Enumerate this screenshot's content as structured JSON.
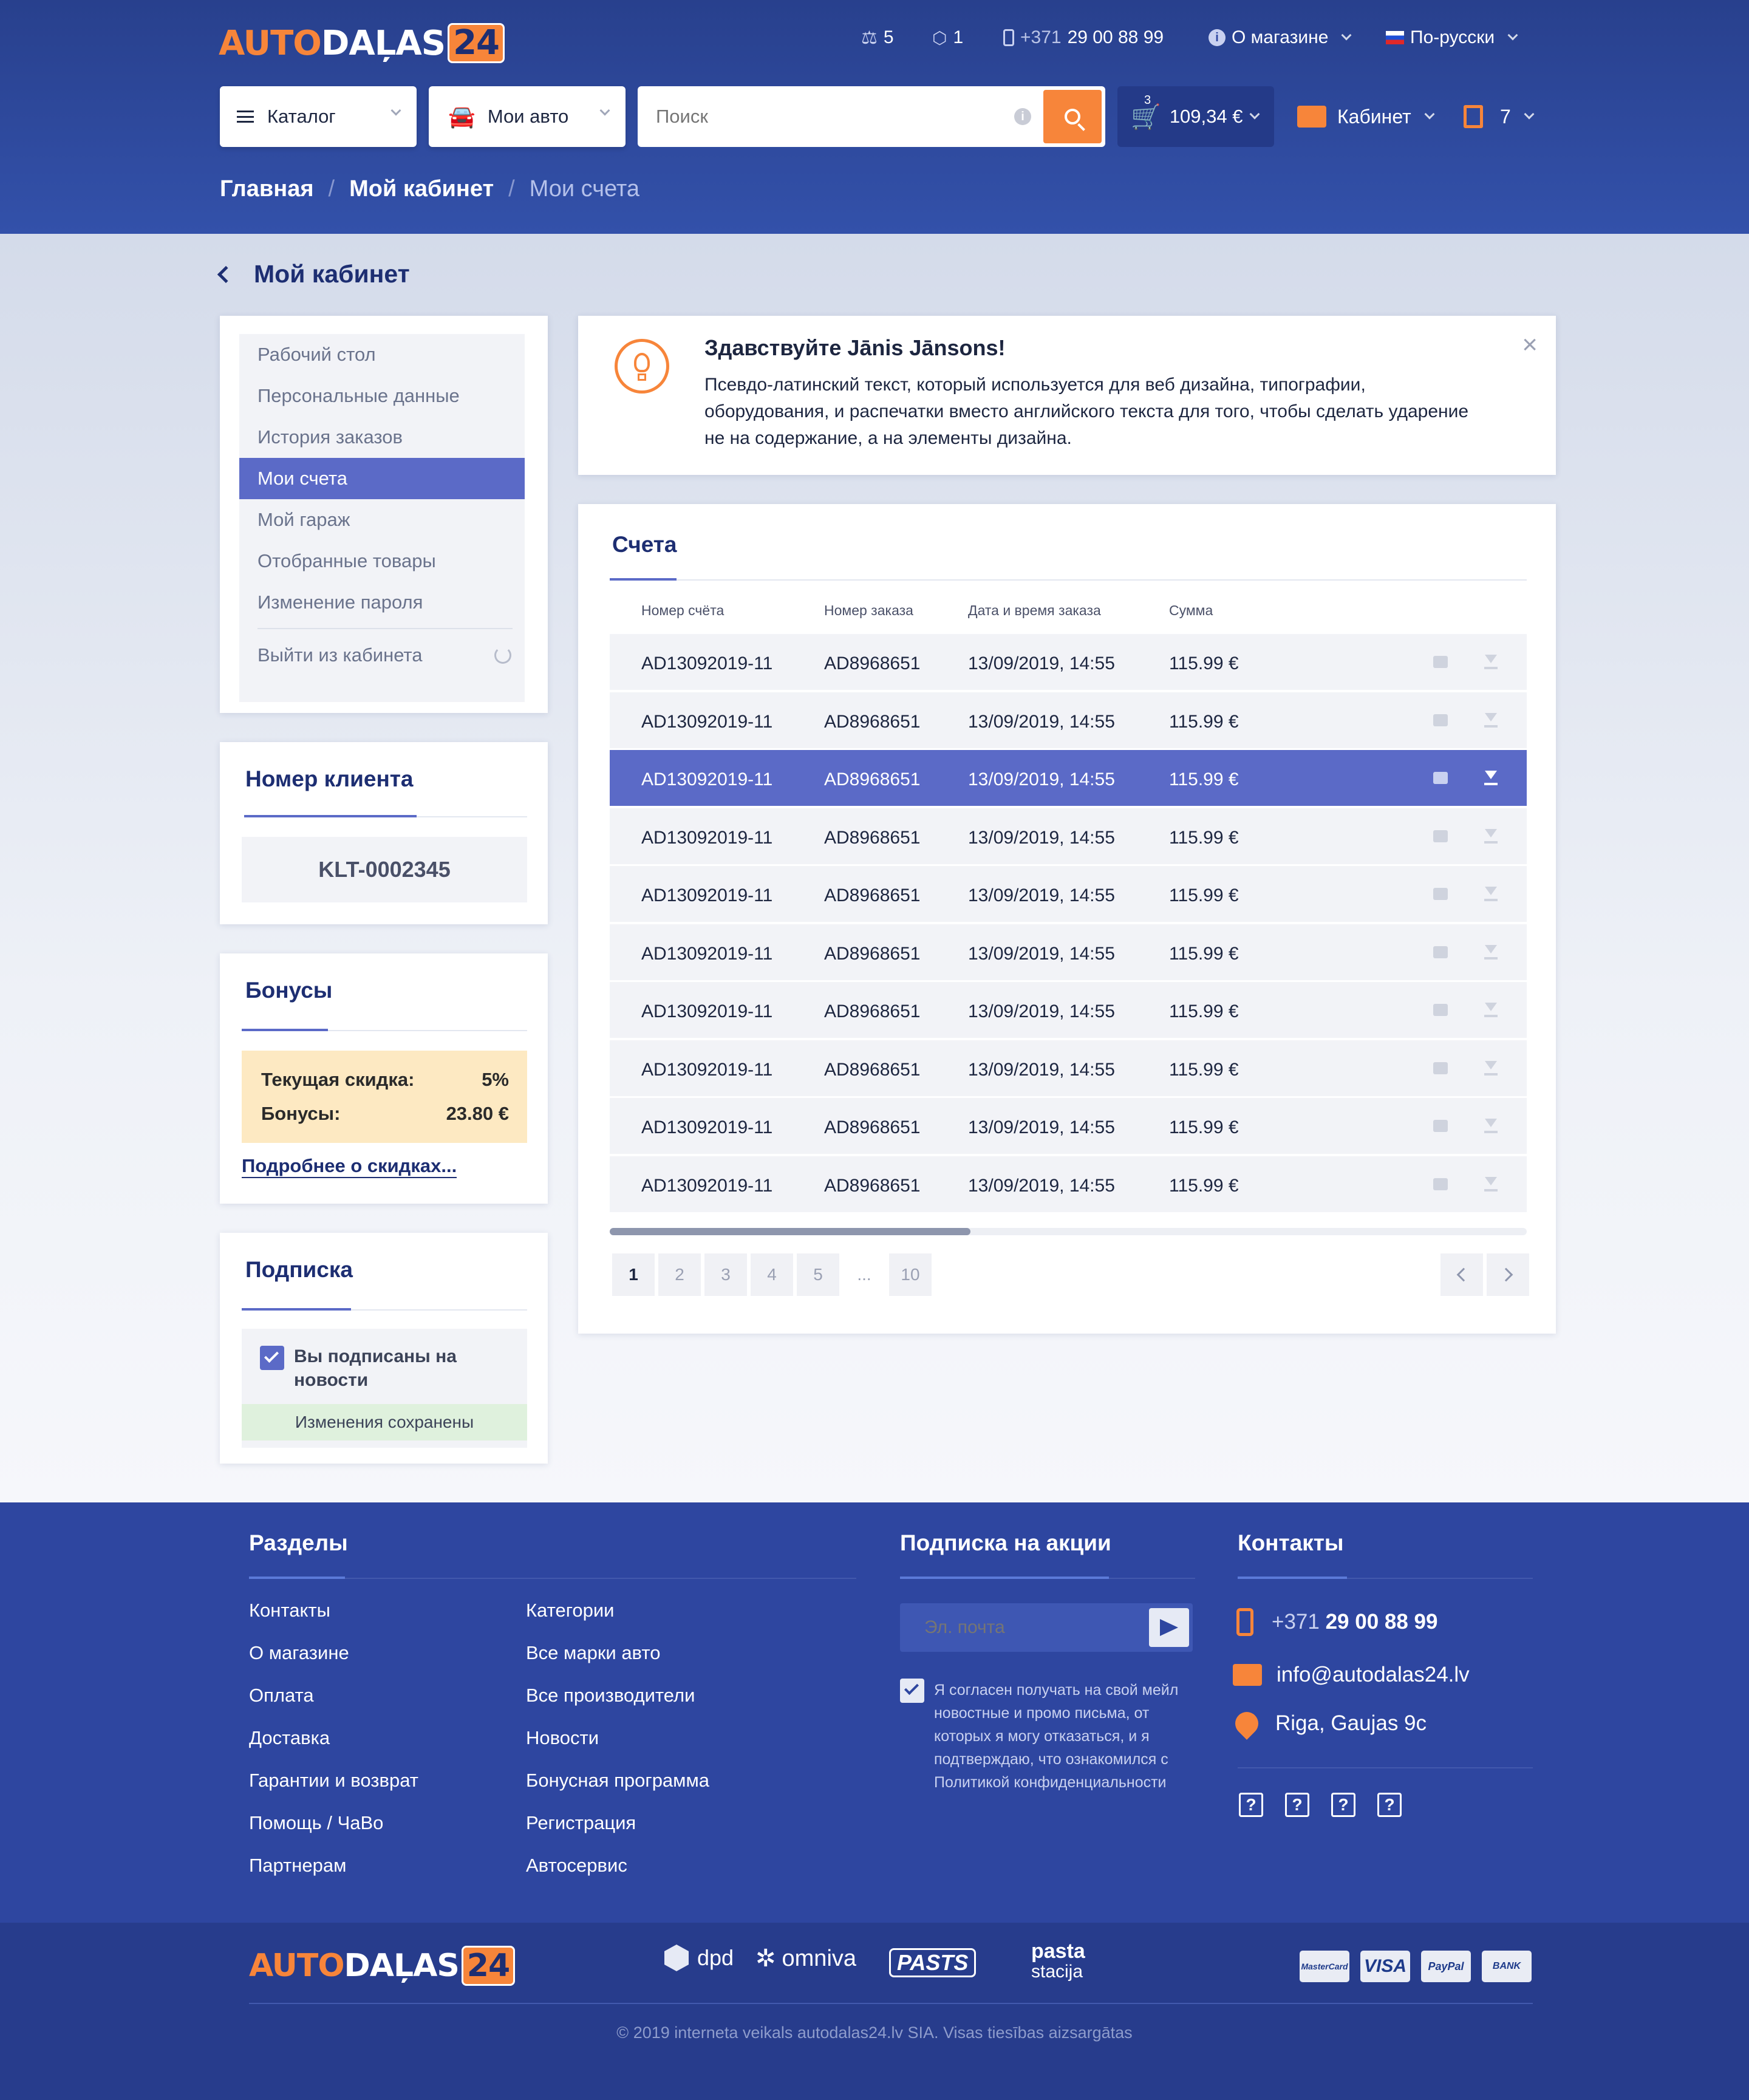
{
  "brand": {
    "auto": "AUTO",
    "dalas": "DAĻAS",
    "num": "24"
  },
  "topbar": {
    "compare_count": "5",
    "box_count": "1",
    "phone_prefix": "+371",
    "phone_number": "29 00 88 99",
    "about": "О магазине",
    "language": "По-русски"
  },
  "toolbar": {
    "catalog": "Каталог",
    "my_car": "Мои авто",
    "search_placeholder": "Поиск",
    "cart_count": "3",
    "cart_total": "109,34 €",
    "cabinet": "Кабинет",
    "favorites_count": "7"
  },
  "breadcrumb": [
    "Главная",
    "Мой кабинет",
    "Мои счета"
  ],
  "page_title": "Мой кабинет",
  "sidebar": {
    "items": [
      {
        "label": "Рабочий стол"
      },
      {
        "label": "Персональные данные"
      },
      {
        "label": "История заказов"
      },
      {
        "label": "Мои счета"
      },
      {
        "label": "Мой гараж"
      },
      {
        "label": "Отобранные товары"
      },
      {
        "label": "Изменение пароля"
      }
    ],
    "logout": "Выйти из кабинета"
  },
  "client": {
    "title": "Номер клиента",
    "number": "KLT-0002345"
  },
  "bonus": {
    "title": "Бонусы",
    "discount_label": "Текущая скидка:",
    "discount_value": "5%",
    "bonus_label": "Бонусы:",
    "bonus_value": "23.80 €",
    "more_link": "Подробнее о скидках..."
  },
  "subscription": {
    "title": "Подписка",
    "checkbox_label": "Вы подписаны на новости",
    "saved": "Изменения сохранены"
  },
  "notice": {
    "title": "Здавствуйте Jānis Jānsons!",
    "text": "Псевдо-латинский текст, который используется для веб дизайна, типографии, оборудования, и распечатки вместо английского текста для того, чтобы сделать ударение не на содержание, а на элементы дизайна."
  },
  "invoices": {
    "title": "Счета",
    "columns": [
      "Номер счёта",
      "Номер заказа",
      "Дата и время заказа",
      "Сумма"
    ],
    "rows": [
      [
        "AD13092019-11",
        "AD8968651",
        "13/09/2019, 14:55",
        "115.99 €"
      ],
      [
        "AD13092019-11",
        "AD8968651",
        "13/09/2019, 14:55",
        "115.99 €"
      ],
      [
        "AD13092019-11",
        "AD8968651",
        "13/09/2019, 14:55",
        "115.99 €"
      ],
      [
        "AD13092019-11",
        "AD8968651",
        "13/09/2019, 14:55",
        "115.99 €"
      ],
      [
        "AD13092019-11",
        "AD8968651",
        "13/09/2019, 14:55",
        "115.99 €"
      ],
      [
        "AD13092019-11",
        "AD8968651",
        "13/09/2019, 14:55",
        "115.99 €"
      ],
      [
        "AD13092019-11",
        "AD8968651",
        "13/09/2019, 14:55",
        "115.99 €"
      ],
      [
        "AD13092019-11",
        "AD8968651",
        "13/09/2019, 14:55",
        "115.99 €"
      ],
      [
        "AD13092019-11",
        "AD8968651",
        "13/09/2019, 14:55",
        "115.99 €"
      ],
      [
        "AD13092019-11",
        "AD8968651",
        "13/09/2019, 14:55",
        "115.99 €"
      ]
    ],
    "highlighted_row": 2,
    "pages": [
      "1",
      "2",
      "3",
      "4",
      "5",
      "...",
      "10"
    ],
    "active_page": "1"
  },
  "footer": {
    "sections_title": "Разделы",
    "col1": [
      "Контакты",
      "О магазине",
      "Оплата",
      "Доставка",
      "Гарантии и возврат",
      "Помощь / ЧаВо",
      "Партнерам"
    ],
    "col2": [
      "Категории",
      "Все марки авто",
      "Все производители",
      "Новости",
      "Бонусная программа",
      "Регистрация",
      "Автосервис"
    ],
    "promo_title": "Подписка на акции",
    "email_placeholder": "Эл. почта",
    "consent": "Я согласен получать на свой мейл новостные и промо письма, от которых я могу отказаться, и я подтверждаю, что ознакомился с Политикой конфиденциальности",
    "contacts_title": "Контакты",
    "phone_prefix": "+371",
    "phone": "29 00 88 99",
    "email": "info@autodalas24.lv",
    "address": "Riga, Gaujas 9c",
    "partners": [
      "dpd",
      "omniva",
      "PASTS",
      "pasta",
      "stacija"
    ],
    "payments": [
      "MasterCard",
      "VISA",
      "PayPal",
      "BANK"
    ],
    "copyright": "© 2019 interneta veikals autodalas24.lv SIA. Visas tiesības aizsargātas"
  },
  "colors": {
    "primary": "#2e46a0",
    "accent": "#f7853a",
    "highlight": "#5b6ac7"
  }
}
